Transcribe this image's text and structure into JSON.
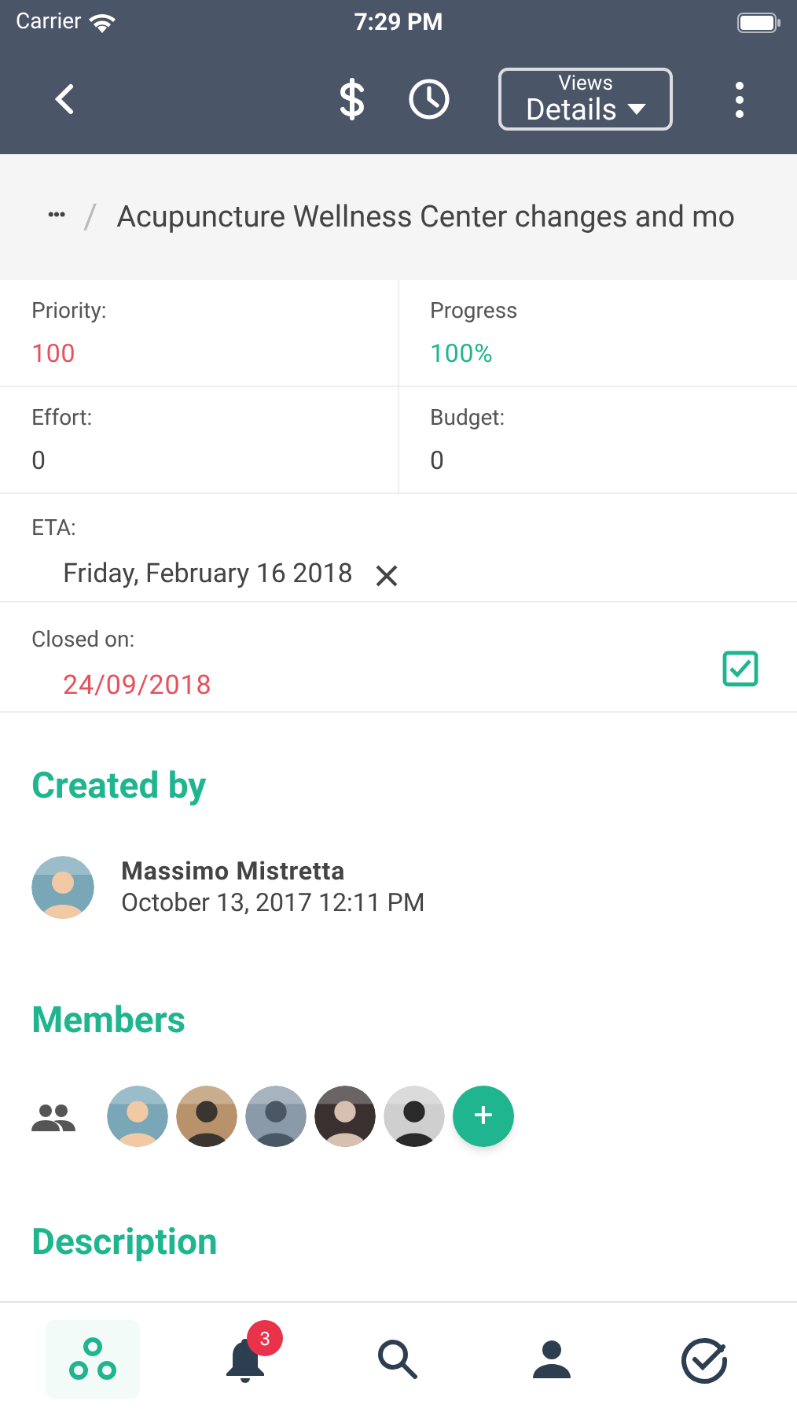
{
  "status_bar": {
    "carrier": "Carrier",
    "time": "7:29 PM"
  },
  "nav": {
    "views_label": "Views",
    "views_value": "Details"
  },
  "breadcrumb": {
    "ellipsis": "•••",
    "separator": "/",
    "title": "Acupuncture Wellness Center changes and mo"
  },
  "fields": [
    {
      "label": "Priority:",
      "value": "100",
      "color": "#e8505b"
    },
    {
      "label": "Progress",
      "value": "100%",
      "color": "#1fb58f"
    },
    {
      "label": "Effort:",
      "value": "0",
      "color": "#444444"
    },
    {
      "label": "Budget:",
      "value": "0",
      "color": "#444444"
    }
  ],
  "eta": {
    "label": "ETA:",
    "value": "Friday, February 16 2018"
  },
  "closed": {
    "label": "Closed on:",
    "value": "24/09/2018",
    "checked": true
  },
  "created_by": {
    "heading": "Created by",
    "name": "Massimo Mistretta",
    "date": "October 13, 2017 12:11 PM"
  },
  "members": {
    "heading": "Members",
    "add": "+"
  },
  "description": {
    "heading": "Description"
  },
  "tab_bar": [
    {
      "kind": "projects",
      "selected": true
    },
    {
      "kind": "notifications",
      "selected": false,
      "badge": "3"
    },
    {
      "kind": "search",
      "selected": false
    },
    {
      "kind": "profile",
      "selected": false
    },
    {
      "kind": "tasks",
      "selected": false
    }
  ]
}
